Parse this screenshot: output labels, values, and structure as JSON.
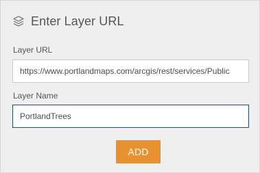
{
  "dialog": {
    "title": "Enter Layer URL",
    "icon": "layers-icon"
  },
  "form": {
    "url_label": "Layer URL",
    "url_value": "https://www.portlandmaps.com/arcgis/rest/services/Public",
    "name_label": "Layer Name",
    "name_value": "PortlandTrees"
  },
  "actions": {
    "add_label": "ADD"
  },
  "colors": {
    "panel_background": "#efefef",
    "add_button": "#e8912f",
    "focused_border": "#1d4b6b"
  }
}
